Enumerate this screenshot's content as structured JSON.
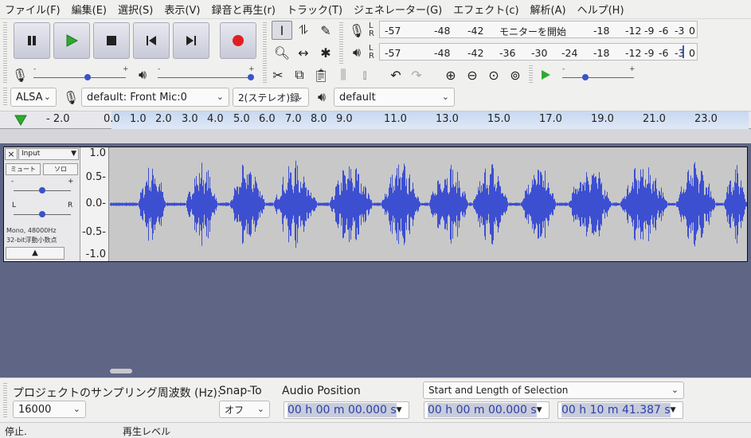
{
  "menu": [
    "ファイル(F)",
    "編集(E)",
    "選択(S)",
    "表示(V)",
    "録音と再生(r)",
    "トラック(T)",
    "ジェネレーター(G)",
    "エフェクト(c)",
    "解析(A)",
    "ヘルプ(H)"
  ],
  "meters": {
    "record_ticks": [
      "-57",
      "-48",
      "-42",
      "モニターを開始",
      "-18",
      "-12",
      "-9",
      "-6",
      "-3",
      "0"
    ],
    "play_ticks": [
      "-57",
      "-48",
      "-42",
      "-36",
      "-30",
      "-24",
      "-18",
      "-12",
      "-9",
      "-6",
      "-3",
      "0"
    ],
    "lr_top": "L",
    "lr_bottom": "R"
  },
  "device": {
    "host": "ALSA",
    "input": "default: Front Mic:0",
    "channels": "2(ステレオ)録",
    "output": "default"
  },
  "ruler": {
    "labels": [
      "- 2.0",
      "0.0",
      "1.0",
      "2.0",
      "3.0",
      "4.0",
      "5.0",
      "6.0",
      "7.0",
      "8.0",
      "9.0",
      "11.0",
      "13.0",
      "15.0",
      "17.0",
      "19.0",
      "21.0",
      "23.0"
    ]
  },
  "track": {
    "name": "Input",
    "mute": "ミュート",
    "solo": "ソロ",
    "pan_left": "L",
    "pan_right": "R",
    "gain_minus": "-",
    "gain_plus": "+",
    "info1": "Mono, 48000Hz",
    "info2": "32-bit浮動小数点",
    "vruler": [
      "1.0",
      "0.5-",
      "0.0-",
      "-0.5-",
      "-1.0"
    ]
  },
  "bottom": {
    "project_rate_label": "プロジェクトのサンプリング周波数 (Hz):",
    "project_rate_value": "16000",
    "snap_label": "Snap-To",
    "snap_value": "オフ",
    "audio_position_label": "Audio Position",
    "audio_position_value": "00 h 00 m 00.000 s",
    "selection_mode": "Start and Length of Selection",
    "selection_start": "00 h 00 m 00.000 s",
    "selection_length": "00 h 10 m 41.387 s"
  },
  "status": {
    "state": "停止.",
    "level": "再生レベル"
  },
  "colors": {
    "waveform": "#3d4fd1",
    "record": "#e02020",
    "play": "#2faa2f",
    "background": "#5f6585"
  }
}
